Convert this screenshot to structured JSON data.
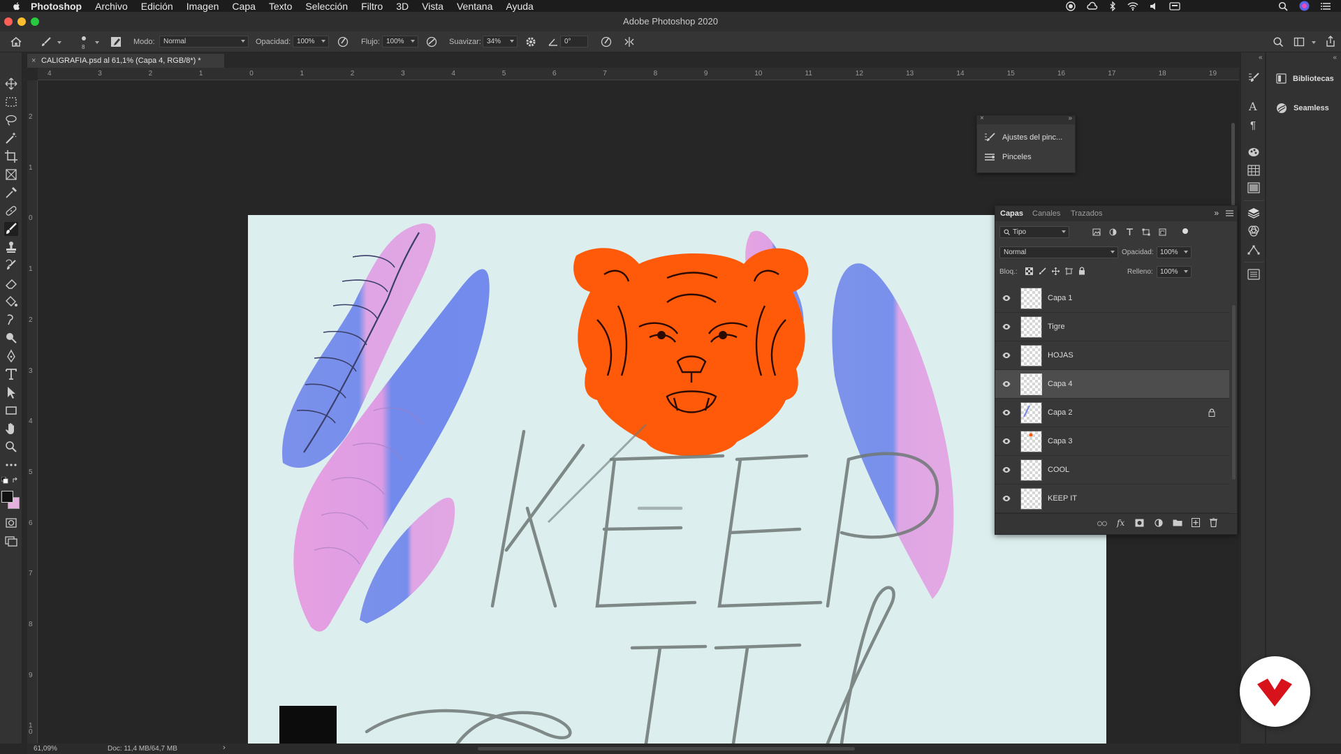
{
  "menubar": {
    "app_name": "Photoshop",
    "items": [
      "Archivo",
      "Edición",
      "Imagen",
      "Capa",
      "Texto",
      "Selección",
      "Filtro",
      "3D",
      "Vista",
      "Ventana",
      "Ayuda"
    ]
  },
  "window": {
    "title": "Adobe Photoshop 2020"
  },
  "options": {
    "brush_size": "8",
    "mode_label": "Modo:",
    "mode_value": "Normal",
    "opacity_label": "Opacidad:",
    "opacity_value": "100%",
    "flow_label": "Flujo:",
    "flow_value": "100%",
    "smooth_label": "Suavizar:",
    "smooth_value": "34%",
    "angle_value": "0°"
  },
  "document": {
    "tab_label": "CALIGRAFIA.psd al 61,1% (Capa 4, RGB/8*) *",
    "close": "×"
  },
  "rulers": {
    "top": [
      "4",
      "3",
      "2",
      "1",
      "0",
      "1",
      "2",
      "3",
      "4",
      "5",
      "6",
      "7",
      "8",
      "9",
      "10",
      "11",
      "12",
      "13",
      "14",
      "15",
      "16",
      "17",
      "18",
      "19"
    ],
    "left": [
      "2",
      "1",
      "0",
      "1",
      "2",
      "3",
      "4",
      "5",
      "6",
      "7",
      "8",
      "9",
      "1 0"
    ]
  },
  "brush_panel": {
    "items": [
      "Ajustes del pinc...",
      "Pinceles"
    ]
  },
  "libraries": {
    "items": [
      "Bibliotecas",
      "Seamless"
    ]
  },
  "layers_panel": {
    "tabs": [
      "Capas",
      "Canales",
      "Trazados"
    ],
    "filter_value": "Tipo",
    "blend_mode": "Normal",
    "opacity_label": "Opacidad:",
    "opacity_value": "100%",
    "lock_label": "Bloq.:",
    "fill_label": "Relleno:",
    "fill_value": "100%",
    "layers": [
      {
        "name": "Capa 1",
        "selected": false,
        "locked": false
      },
      {
        "name": "Tigre",
        "selected": false,
        "locked": false
      },
      {
        "name": "HOJAS",
        "selected": false,
        "locked": false
      },
      {
        "name": "Capa 4",
        "selected": true,
        "locked": false
      },
      {
        "name": "Capa 2",
        "selected": false,
        "locked": true
      },
      {
        "name": "Capa 3",
        "selected": false,
        "locked": false
      },
      {
        "name": "COOL",
        "selected": false,
        "locked": false
      },
      {
        "name": "KEEP IT",
        "selected": false,
        "locked": false
      }
    ]
  },
  "status": {
    "zoom": "61,09%",
    "doc_size": "Doc: 11,4 MB/64,7 MB"
  },
  "colors": {
    "artboard_bg": "#dcefee",
    "tiger": "#ff5a0a",
    "leaf_pink": "#e49de0",
    "leaf_blue": "#6d86ec",
    "pencil": "#707a78",
    "badge_red": "#d8121b"
  }
}
